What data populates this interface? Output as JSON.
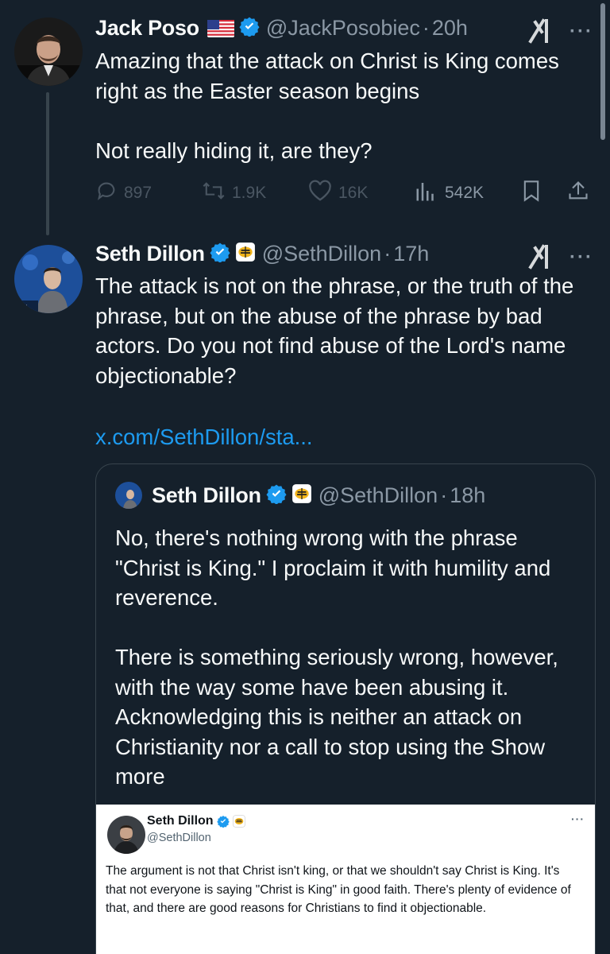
{
  "tweet1": {
    "name": "Jack Poso",
    "handle": "@JackPosobiec",
    "time": "20h",
    "text": "Amazing that the attack on Christ is King comes right as the Easter season begins\n\nNot really hiding it, are they?",
    "replies": "897",
    "retweets": "1.9K",
    "likes": "16K",
    "views": "542K",
    "flag_icon": "us-flag-icon"
  },
  "tweet2": {
    "name": "Seth Dillon",
    "handle": "@SethDillon",
    "time": "17h",
    "text": "The attack is not on the phrase, or the truth of the phrase, but on the abuse of the phrase by bad actors. Do you not find abuse of the Lord's name objectionable?",
    "link": "x.com/SethDillon/sta..."
  },
  "quote": {
    "name": "Seth Dillon",
    "handle": "@SethDillon",
    "time": "18h",
    "text": "No, there's nothing wrong with the phrase \"Christ is King.\" I proclaim it with humility and reverence.\n\nThere is something seriously wrong, however, with the way some have been abusing it. Acknowledging this is neither an attack on Christianity nor a call to stop using the",
    "show_more": "Show more"
  },
  "screenshot": {
    "name": "Seth Dillon",
    "handle": "@SethDillon",
    "more": "···",
    "text": "The argument is not that Christ isn't king, or that we shouldn't say Christ is King. It's that not everyone is saying \"Christ is King\" in good faith. There's plenty of evidence of that, and there are good reasons for Christians to find it objectionable."
  },
  "ui": {
    "dot": "·",
    "more": "···"
  },
  "colors": {
    "background": "#15202b",
    "text": "#f7f9f9",
    "secondary": "#8b98a5",
    "link": "#1d9bf0",
    "verified": "#1d9bf0",
    "border": "#38444d"
  }
}
